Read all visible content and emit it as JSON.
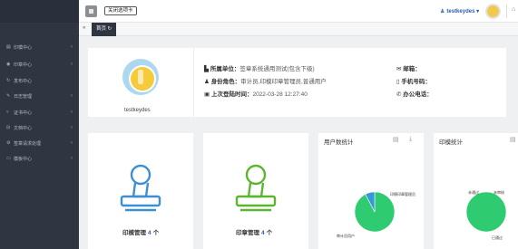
{
  "header": {
    "tooltip": "关闭选项卡",
    "username": "testkeydes"
  },
  "tabs": {
    "home": "首页"
  },
  "sidebar": {
    "items": [
      {
        "label": "印模中心",
        "icon": "printer-icon"
      },
      {
        "label": "印章中心",
        "icon": "stamp-icon"
      },
      {
        "label": "发布中心",
        "icon": "publish-icon"
      },
      {
        "label": "日志管理",
        "icon": "edit-icon"
      },
      {
        "label": "证书中心",
        "icon": "certificate-icon"
      },
      {
        "label": "文档中心",
        "icon": "document-icon"
      },
      {
        "label": "签章请求处理",
        "icon": "gear-icon"
      },
      {
        "label": "模板中心",
        "icon": "template-icon"
      }
    ]
  },
  "profile": {
    "name": "testkeydes",
    "unit_label": "所属单位：",
    "unit_value": "签章系统通用测试(包含下级)",
    "role_label": "身份角色：",
    "role_value": "审计员,印模印章管理员,普通用户",
    "login_label": "上次登陆时间：",
    "login_value": "2022-03-28 12:27:40",
    "email_label": "邮箱：",
    "phone_label": "手机号码：",
    "office_label": "办公电话："
  },
  "stats": [
    {
      "label": "印模管理",
      "count": "4",
      "unit": "个",
      "color": "#3d8fd1"
    },
    {
      "label": "印章管理",
      "count": "4",
      "unit": "个",
      "color": "#5cb531"
    }
  ],
  "chart_data": [
    {
      "type": "pie",
      "title": "用户数统计",
      "labels": [
        "普通用户",
        "审计员",
        "印模印章管理员"
      ],
      "values": [
        12,
        1,
        0
      ],
      "colors": [
        "#2fcb71",
        "#3498db",
        "#e74c3c"
      ],
      "visible_labels": {
        "top": "印模印章管理员",
        "bottom": "审计员用户"
      }
    },
    {
      "type": "pie",
      "title": "印模统计",
      "labels": [
        "已通过",
        "未通过",
        "未审核"
      ],
      "values": [
        1,
        0,
        0
      ],
      "colors": [
        "#2fcb71",
        "#3498db",
        "#e74c3c"
      ],
      "visible_labels": {
        "left": "未通过",
        "right": "未审核",
        "bottom": "已通过"
      }
    }
  ]
}
